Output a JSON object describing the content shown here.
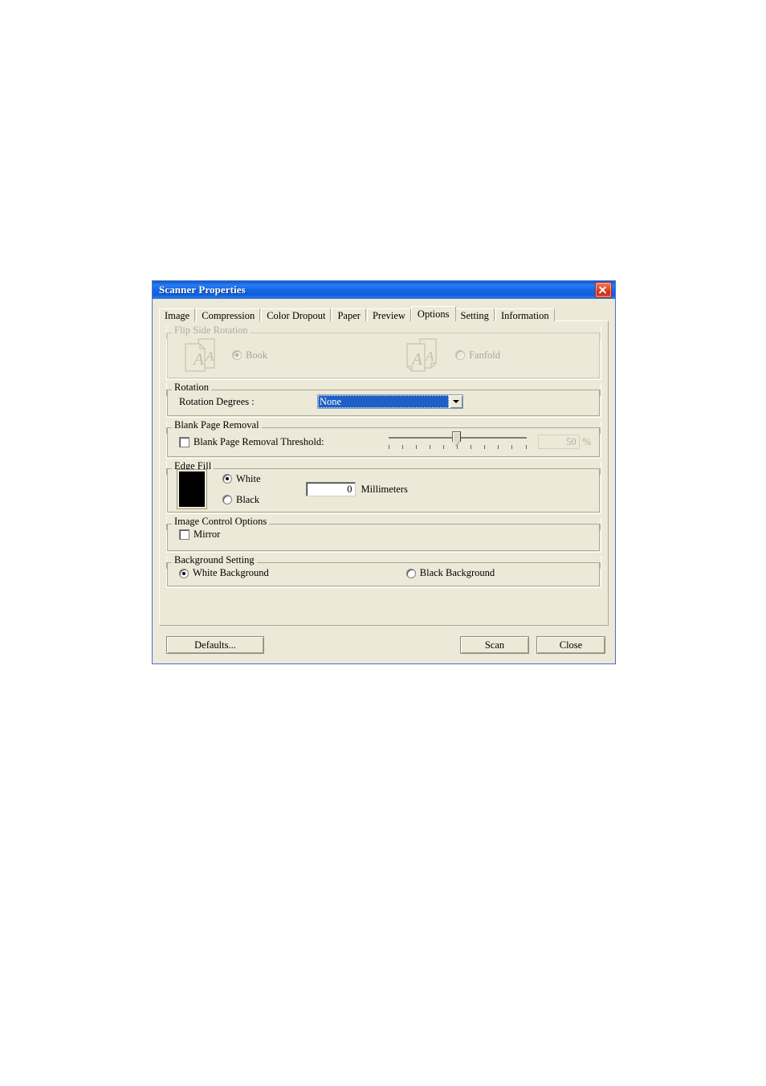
{
  "window": {
    "title": "Scanner Properties",
    "close_icon": "close-icon"
  },
  "tabs": [
    {
      "label": "Image",
      "active": false
    },
    {
      "label": "Compression",
      "active": false
    },
    {
      "label": "Color Dropout",
      "active": false
    },
    {
      "label": "Paper",
      "active": false
    },
    {
      "label": "Preview",
      "active": false
    },
    {
      "label": "Options",
      "active": true
    },
    {
      "label": "Setting",
      "active": false
    },
    {
      "label": "Information",
      "active": false
    }
  ],
  "groups": {
    "flip_side_rotation": {
      "legend": "Flip Side Rotation",
      "enabled": false,
      "book": {
        "label": "Book",
        "selected": true,
        "icon": "document-pages-book-icon"
      },
      "fanfold": {
        "label": "Fanfold",
        "selected": false,
        "icon": "document-pages-fanfold-icon"
      }
    },
    "rotation": {
      "legend": "Rotation",
      "field_label": "Rotation Degrees :",
      "value": "None",
      "dropdown_icon": "chevron-down-icon"
    },
    "blank_page_removal": {
      "legend": "Blank Page Removal",
      "checkbox_label": "Blank Page Removal Threshold:",
      "checked": false,
      "slider_value": 50,
      "slider_min": 0,
      "slider_max": 100,
      "slider_ticks": 11,
      "percent_value": "50",
      "percent_symbol": "%",
      "enabled": false
    },
    "edge_fill": {
      "legend": "Edge Fill",
      "swatch_color": "#000000",
      "white": {
        "label": "White",
        "selected": true
      },
      "black": {
        "label": "Black",
        "selected": false
      },
      "amount_value": "0",
      "unit_label": "Millimeters"
    },
    "image_control_options": {
      "legend": "Image Control Options",
      "mirror": {
        "label": "Mirror",
        "checked": false
      }
    },
    "background_setting": {
      "legend": "Background Setting",
      "white_background": {
        "label": "White Background",
        "selected": true
      },
      "black_background": {
        "label": "Black Background",
        "selected": false
      }
    }
  },
  "buttons": {
    "defaults": "Defaults...",
    "scan": "Scan",
    "close": "Close"
  },
  "colors": {
    "titlebar_blue": "#1467e4",
    "dialog_face": "#ece9d8",
    "selection_blue": "#1d5fc4",
    "close_red": "#c52e14"
  }
}
